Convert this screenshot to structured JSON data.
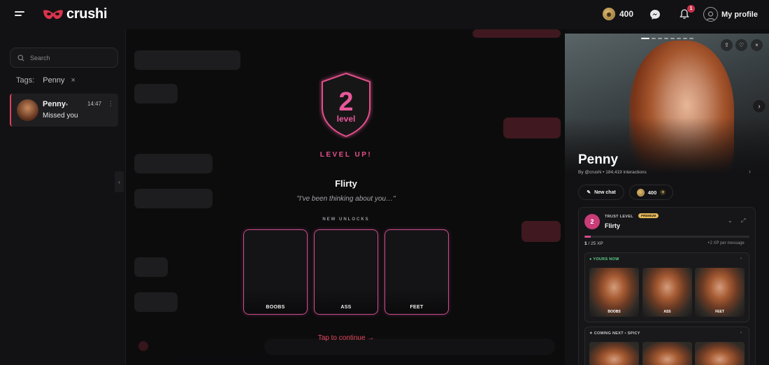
{
  "app": {
    "brand": "crushi",
    "brand_color": "#d9344c"
  },
  "topbar": {
    "coins": "400",
    "notification_count": "1",
    "profile_label": "My profile"
  },
  "sidebar": {
    "search_placeholder": "Search",
    "tags_label": "Tags:",
    "tag": "Penny",
    "conversation": {
      "name": "Penny",
      "time": "14:47",
      "last_message": "Missed you"
    }
  },
  "modal": {
    "level_number": "2",
    "level_word": "level",
    "level_up": "LEVEL UP!",
    "level_name": "Flirty",
    "quote": "\"I've been thinking about you…\"",
    "new_unlocks": "NEW UNLOCKS",
    "unlocks": [
      "BOOBS",
      "ASS",
      "FEET"
    ],
    "tap_continue": "Tap to continue",
    "accent": "#e4508a"
  },
  "profile": {
    "name": "Penny",
    "byline": "By @crushi • 184,419 interactions",
    "new_chat": "New chat",
    "coins": "400",
    "trust": {
      "label": "TRUST LEVEL",
      "premium": "PREMIUM",
      "level": "2",
      "name": "Flirty",
      "xp_current": "1",
      "xp_total": "/ 25 XP",
      "xp_progress": 0.04,
      "xp_per": "+2 XP per message",
      "yours_now": "YOURS NOW",
      "yours_items": [
        "BOOBS",
        "ASS",
        "FEET"
      ],
      "coming_next": "COMING NEXT • SPICY"
    }
  }
}
